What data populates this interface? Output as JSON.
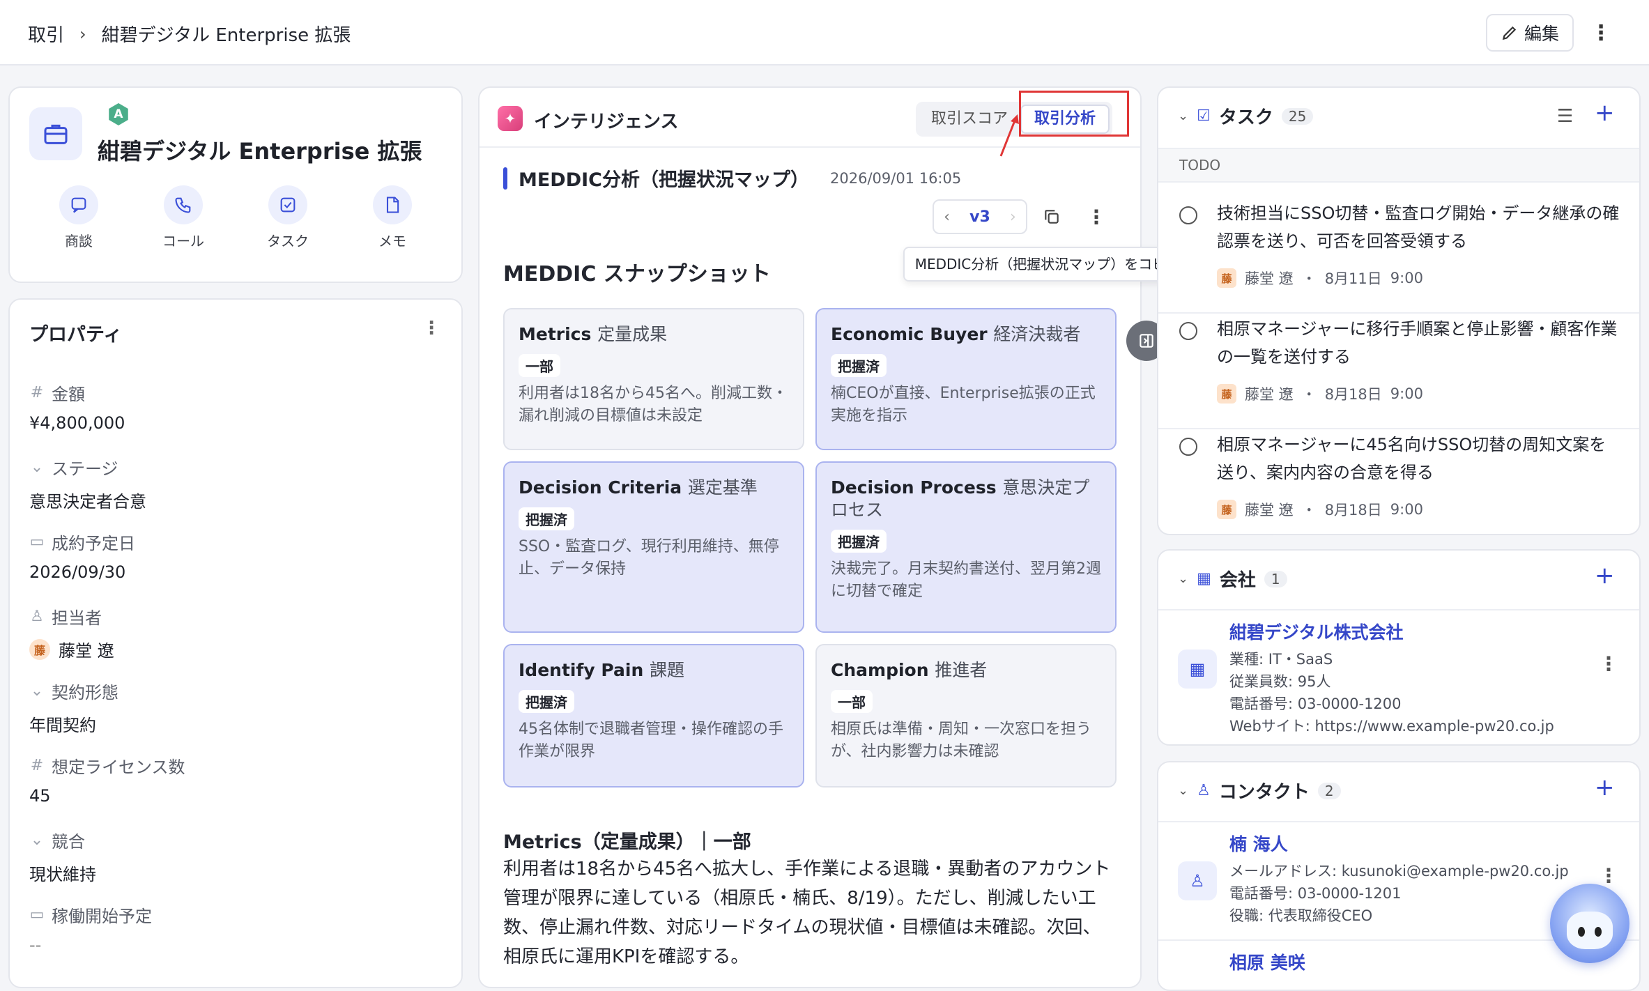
{
  "breadcrumb": {
    "root": "取引",
    "sep": "›",
    "current": "紺碧デジタル Enterprise 拡張"
  },
  "toolbar": {
    "edit_label": "編集",
    "more": "⋮"
  },
  "deal": {
    "rank_badge": "A",
    "title": "紺碧デジタル Enterprise 拡張",
    "actions": [
      "商談",
      "コール",
      "タスク",
      "メモ"
    ]
  },
  "properties": {
    "title": "プロパティ",
    "items": [
      {
        "label": "金額",
        "value": "¥4,800,000"
      },
      {
        "label": "ステージ",
        "value": "意思決定者合意"
      },
      {
        "label": "成約予定日",
        "value": "2026/09/30"
      },
      {
        "label": "担当者",
        "value": "藤堂 遼",
        "avatar": "藤"
      },
      {
        "label": "契約形態",
        "value": "年間契約"
      },
      {
        "label": "想定ライセンス数",
        "value": "45"
      },
      {
        "label": "競合",
        "value": "現状維持"
      },
      {
        "label": "稼働開始予定",
        "value": "--"
      }
    ]
  },
  "intelligence": {
    "title": "インテリジェンス",
    "tabs": [
      "取引スコア",
      "取引分析"
    ],
    "active_tab": "取引分析",
    "section_title": "MEDDIC分析（把握状況マップ）",
    "timestamp": "2026/09/01 16:05",
    "version": "v3",
    "copy_tooltip": "MEDDIC分析（把握状況マップ）をコピー",
    "snapshot_title": "MEDDIC スナップショット",
    "cards": [
      {
        "en": "Metrics",
        "ja": "定量成果",
        "status": "一部",
        "full": false,
        "desc": "利用者は18名から45名へ。削減工数・漏れ削減の目標値は未設定"
      },
      {
        "en": "Economic Buyer",
        "ja": "経済決裁者",
        "status": "把握済",
        "full": true,
        "desc": "楠CEOが直接、Enterprise拡張の正式実施を指示"
      },
      {
        "en": "Decision Criteria",
        "ja": "選定基準",
        "status": "把握済",
        "full": true,
        "desc": "SSO・監査ログ、現行利用維持、無停止、データ保持"
      },
      {
        "en": "Decision Process",
        "ja": "意思決定プロセス",
        "status": "把握済",
        "full": true,
        "desc": "決裁完了。月末契約書送付、翌月第2週に切替で確定"
      },
      {
        "en": "Identify Pain",
        "ja": "課題",
        "status": "把握済",
        "full": true,
        "desc": "45名体制で退職者管理・操作確認の手作業が限界"
      },
      {
        "en": "Champion",
        "ja": "推進者",
        "status": "一部",
        "full": false,
        "desc": "相原氏は準備・周知・一次窓口を担うが、社内影響力は未確認"
      }
    ],
    "detail_title": "Metrics（定量成果）｜一部",
    "detail_body": "利用者は18名から45名へ拡大し、手作業による退職・異動者のアカウント管理が限界に達している（相原氏・楠氏、8/19）。ただし、削減したい工数、停止漏れ件数、対応リードタイムの現状値・目標値は未確認。次回、相原氏に運用KPIを確認する。"
  },
  "tasks": {
    "title": "タスク",
    "count": "25",
    "group": "TODO",
    "items": [
      {
        "text": "技術担当にSSO切替・監査ログ開始・データ継承の確認票を送り、可否を回答受領する",
        "avatar": "藤",
        "owner": "藤堂 遼",
        "date": "8月11日",
        "time": "9:00"
      },
      {
        "text": "相原マネージャーに移行手順案と停止影響・顧客作業の一覧を送付する",
        "avatar": "藤",
        "owner": "藤堂 遼",
        "date": "8月18日",
        "time": "9:00"
      },
      {
        "text": "相原マネージャーに45名向けSSO切替の周知文案を送り、案内内容の合意を得る",
        "avatar": "藤",
        "owner": "藤堂 遼",
        "date": "8月18日",
        "time": "9:00"
      }
    ]
  },
  "company": {
    "title": "会社",
    "count": "1",
    "name": "紺碧デジタル株式会社",
    "lines": [
      "業種: IT・SaaS",
      "従業員数: 95人",
      "電話番号: 03-0000-1200",
      "Webサイト: https://www.example-pw20.co.jp"
    ]
  },
  "contacts": {
    "title": "コンタクト",
    "count": "2",
    "items": [
      {
        "name": "楠 海人",
        "lines": [
          "メールアドレス: kusunoki@example-pw20.co.jp",
          "電話番号: 03-0000-1201",
          "役職: 代表取締役CEO"
        ]
      },
      {
        "name": "相原 美咲",
        "lines": []
      }
    ]
  },
  "colors": {
    "accent": "#3547c8",
    "annotation": "#e03636",
    "full_card": "#e5e7fa"
  }
}
